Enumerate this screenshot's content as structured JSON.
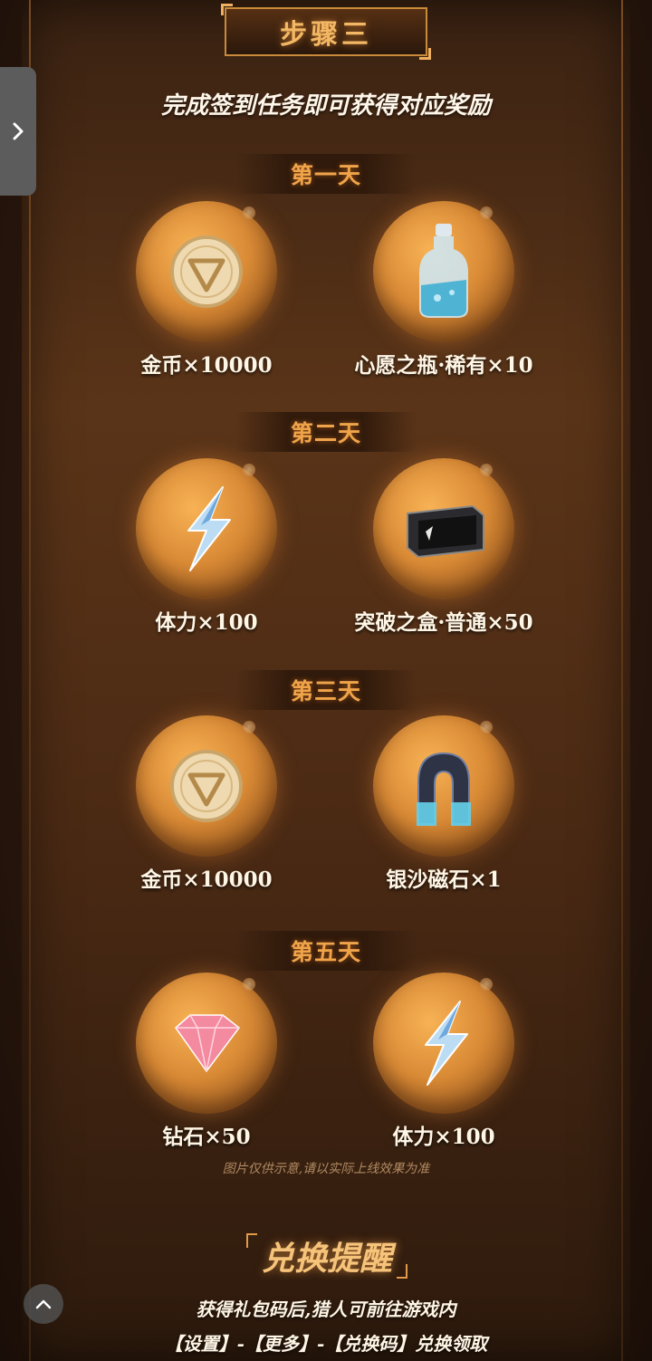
{
  "step": {
    "title": "步骤三"
  },
  "subtitle": "完成签到任务即可获得对应奖励",
  "days": [
    {
      "label": "第一天",
      "rewards": [
        {
          "name": "金币×10000",
          "icon": "gold-coin-icon"
        },
        {
          "name": "心愿之瓶·稀有×10",
          "icon": "wish-bottle-icon"
        }
      ]
    },
    {
      "label": "第二天",
      "rewards": [
        {
          "name": "体力×100",
          "icon": "stamina-bolt-icon"
        },
        {
          "name": "突破之盒·普通×50",
          "icon": "breakthrough-box-icon"
        }
      ]
    },
    {
      "label": "第三天",
      "rewards": [
        {
          "name": "金币×10000",
          "icon": "gold-coin-icon"
        },
        {
          "name": "银沙磁石×1",
          "icon": "magnet-icon"
        }
      ]
    },
    {
      "label": "第五天",
      "rewards": [
        {
          "name": "钻石×50",
          "icon": "diamond-icon"
        },
        {
          "name": "体力×100",
          "icon": "stamina-bolt-icon"
        }
      ]
    }
  ],
  "note": "图片仅供示意,请以实际上线效果为准",
  "reminder": {
    "title": "兑换提醒",
    "line1": "获得礼包码后,猎人可前往游戏内",
    "line2": "【设置】-【更多】-【兑换码】兑换领取"
  },
  "colors": {
    "accent": "#f0a44a",
    "orb": "#d98a35"
  }
}
